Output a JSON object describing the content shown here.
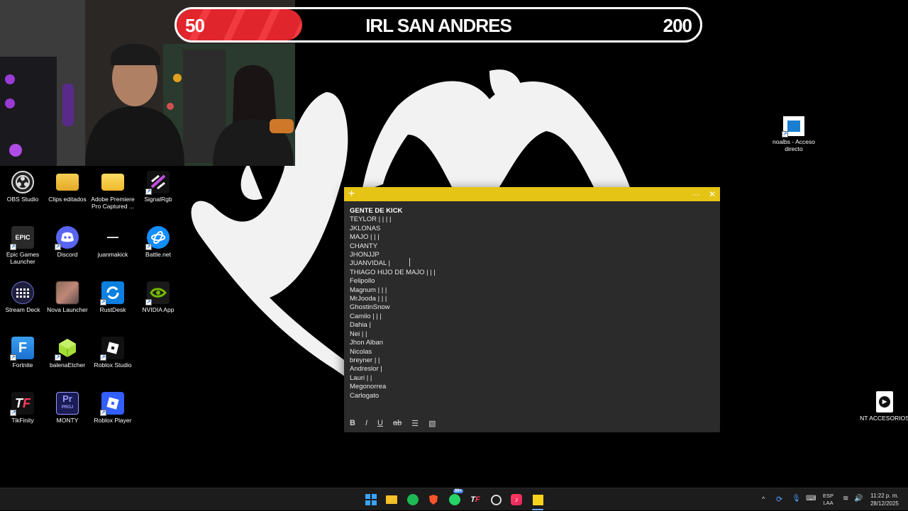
{
  "overlay": {
    "counter_left": "50",
    "counter_title": "IRL SAN ANDRES",
    "counter_right": "200",
    "progress_fraction": 0.25
  },
  "desktop_icons": [
    {
      "label": "OBS Studio",
      "icon": "obs-icon"
    },
    {
      "label": "Clips editados",
      "icon": "folder-icon"
    },
    {
      "label": "Adobe Premiere Pro Captured ...",
      "icon": "folder-icon"
    },
    {
      "label": "SignalRgb",
      "icon": "signalrgb-icon"
    },
    {
      "label": "Epic Games Launcher",
      "icon": "epic-games-icon"
    },
    {
      "label": "Discord",
      "icon": "discord-icon"
    },
    {
      "label": "juanmakick",
      "icon": "file-icon"
    },
    {
      "label": "Battle.net",
      "icon": "battlenet-icon"
    },
    {
      "label": "Stream Deck",
      "icon": "stream-deck-icon"
    },
    {
      "label": "Nova Launcher",
      "icon": "nova-launcher-icon"
    },
    {
      "label": "RustDesk",
      "icon": "rustdesk-icon"
    },
    {
      "label": "NVIDIA App",
      "icon": "nvidia-icon"
    },
    {
      "label": "Fortnite",
      "icon": "fortnite-icon"
    },
    {
      "label": "balenaEtcher",
      "icon": "balena-etcher-icon"
    },
    {
      "label": "Roblox Studio",
      "icon": "roblox-studio-icon"
    },
    {
      "label": "TikFinity",
      "icon": "tikfinity-icon"
    },
    {
      "label": "MONTY",
      "icon": "premiere-project-icon"
    },
    {
      "label": "Roblox Player",
      "icon": "roblox-player-icon"
    }
  ],
  "right_icons": [
    {
      "label": "noalbs - Acceso directo",
      "icon": "shortcut-icon"
    },
    {
      "label": "NT ACCESORIOS",
      "icon": "video-file-icon"
    }
  ],
  "sticky_note": {
    "heading": "GENTE DE KICK",
    "lines": [
      "TEYLOR | | | |",
      "JKLONAS",
      "MAJO | | |",
      "CHANTY",
      "JHONJJP",
      "JUANVIDAL |",
      "THIAGO HIJO DE MAJO | | |",
      "Felipollo",
      "Magnum | | |",
      "MrJooda | | |",
      "GhostinSnow",
      "Camilo | | |",
      "Dahia |",
      "Nei | |",
      "Jhon Alban",
      "Nicolas",
      "breyner | |",
      "Andreslor |",
      "Lauri | |",
      "Megonorrea",
      "Carlogato"
    ],
    "toolbar": {
      "bold": "B",
      "italic": "I",
      "underline": "U",
      "strike": "ab"
    },
    "accent": "#e5c415"
  },
  "taskbar": {
    "apps": [
      "windows-start-icon",
      "file-explorer-icon",
      "spotify-icon",
      "brave-icon",
      "whatsapp-icon",
      "tikfinity-icon",
      "obs-icon",
      "tiktok-icon",
      "sticky-notes-icon"
    ],
    "whatsapp_badge": "99+",
    "lang_top": "ESP",
    "lang_bottom": "LAA",
    "time": "11:22 p. m.",
    "date": "28/12/2025"
  }
}
